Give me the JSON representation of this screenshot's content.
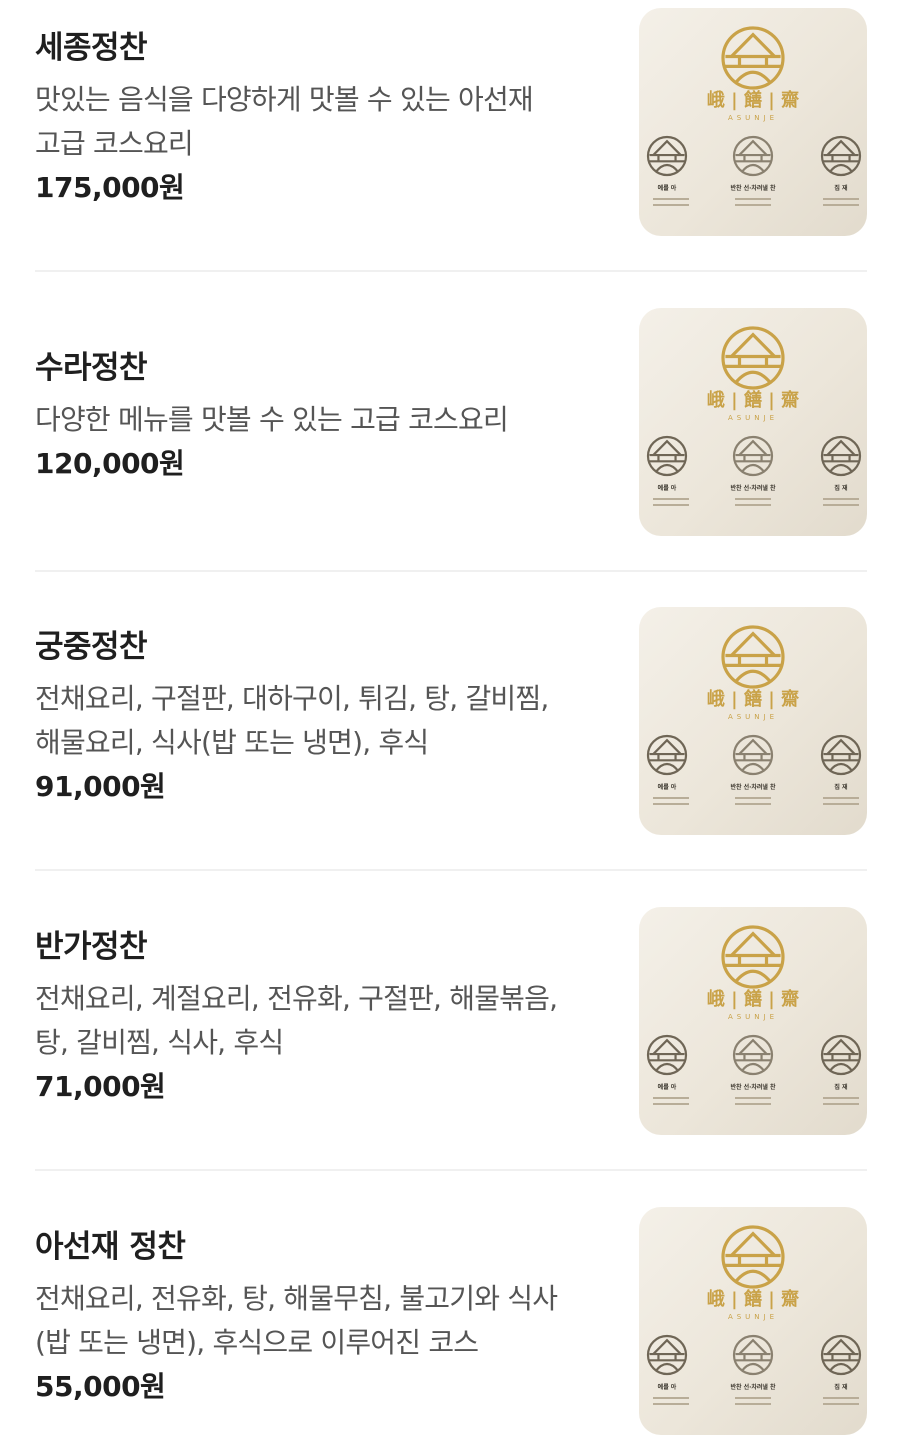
{
  "menu": {
    "items": [
      {
        "name": "세종정찬",
        "desc_lines": [
          "맛있는 음식을 다양하게 맛볼 수 있는 아선재",
          "고급 코스요리"
        ],
        "price": "175,000원"
      },
      {
        "name": "수라정찬",
        "desc_lines": [
          "다양한 메뉴를 맛볼 수 있는 고급 코스요리"
        ],
        "price": "120,000원"
      },
      {
        "name": "궁중정찬",
        "desc_lines": [
          "전채요리, 구절판, 대하구이, 튀김, 탕, 갈비찜,",
          "해물요리, 식사(밥 또는 냉면), 후식"
        ],
        "price": "91,000원"
      },
      {
        "name": "반가정찬",
        "desc_lines": [
          "전채요리, 계절요리, 전유화, 구절판, 해물볶음,",
          "탕, 갈비찜, 식사, 후식"
        ],
        "price": "71,000원"
      },
      {
        "name": "아선재 정찬",
        "desc_lines": [
          "전채요리, 전유화, 탕, 해물무침, 불고기와 식사",
          "(밥 또는 냉면), 후식으로 이루어진 코스"
        ],
        "price": "55,000원"
      }
    ],
    "thumbnail": {
      "brand_hanja": "峨 | 饍 | 齋",
      "brand_latin": "ASUNJE",
      "sub_labels": [
        "예를 아",
        "반찬 선·차려낼 찬",
        "집 재"
      ],
      "gold_color": "#c9a248",
      "icon_color": "#8a8170"
    }
  }
}
